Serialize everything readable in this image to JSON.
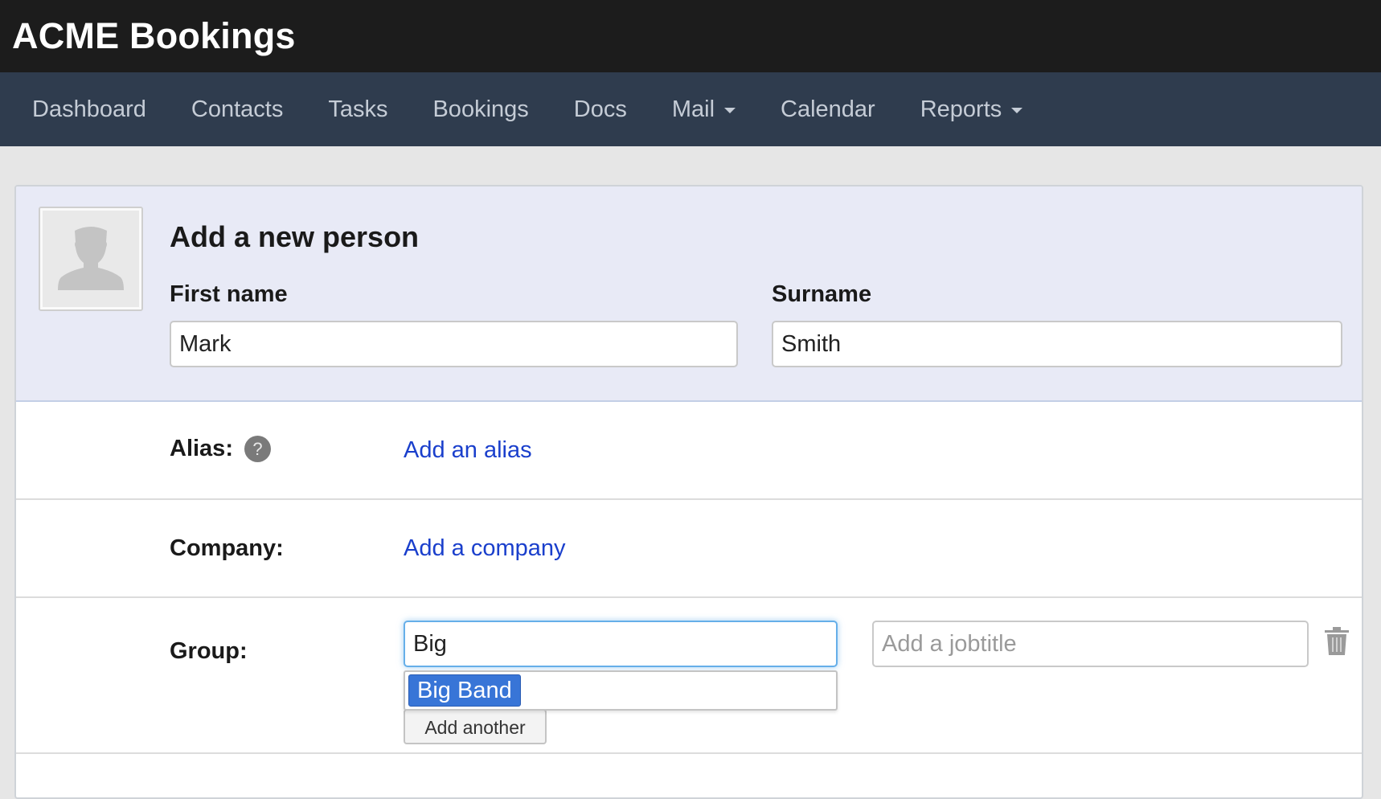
{
  "app": {
    "brand": "ACME Bookings"
  },
  "nav": {
    "dashboard": "Dashboard",
    "contacts": "Contacts",
    "tasks": "Tasks",
    "bookings": "Bookings",
    "docs": "Docs",
    "mail": "Mail",
    "calendar": "Calendar",
    "reports": "Reports"
  },
  "form": {
    "title": "Add a new person",
    "first_name_label": "First name",
    "first_name_value": "Mark",
    "surname_label": "Surname",
    "surname_value": "Smith",
    "alias_label": "Alias:",
    "alias_help": "?",
    "alias_link": "Add an alias",
    "company_label": "Company:",
    "company_link": "Add a company",
    "group_label": "Group:",
    "group_value": "Big",
    "group_suggestions": [
      "Big Band"
    ],
    "jobtitle_placeholder": "Add a jobtitle",
    "add_another": "Add another"
  },
  "icons": {
    "avatar": "person-silhouette-icon",
    "help": "question-mark-icon",
    "delete": "trash-icon",
    "dropdown": "caret-down-icon"
  },
  "colors": {
    "topbar": "#1c1c1c",
    "navbar": "#2f3c4e",
    "link": "#1a3fcc",
    "highlight": "#3875d7",
    "header_panel": "#e8eaf6"
  }
}
